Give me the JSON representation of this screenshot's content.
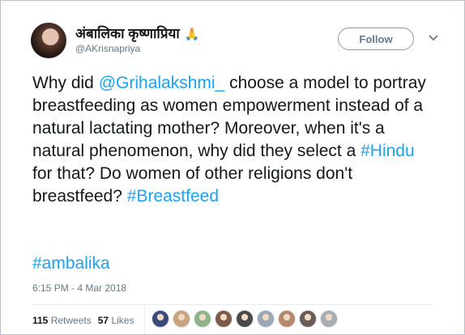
{
  "user": {
    "name": "अंबालिका कृष्णाप्रिया",
    "handle": "@AKrisnapriya",
    "emoji_icon": "folded-hands-icon"
  },
  "follow": {
    "label": "Follow"
  },
  "tweet": {
    "part1": "Why did ",
    "mention": "@Grihalakshmi_",
    "part2": " choose a model to portray breastfeeding as women empowerment instead of a natural lactating mother? Moreover, when it's a natural phenomenon, why did they select a ",
    "hashtag_hindu": "#Hindu",
    "part3": " for that? Do women of other religions don't breastfeed? ",
    "hashtag_breastfeed": "#Breastfeed",
    "hashtag_ambalika": "#ambalika"
  },
  "timestamp": "6:15 PM - 4 Mar 2018",
  "stats": {
    "retweets_count": "115",
    "retweets_label": "Retweets",
    "likes_count": "57",
    "likes_label": "Likes"
  },
  "colors": {
    "link": "#1da1f2",
    "text": "#14171a",
    "muted": "#657786"
  },
  "likers": [
    {
      "color": "#3b4a7a"
    },
    {
      "color": "#c9a27e"
    },
    {
      "color": "#8fb38a"
    },
    {
      "color": "#7a5c48"
    },
    {
      "color": "#4a4a4a"
    },
    {
      "color": "#9aa7b4"
    },
    {
      "color": "#b58a6a"
    },
    {
      "color": "#6b5d55"
    },
    {
      "color": "#a9aeb3"
    }
  ]
}
